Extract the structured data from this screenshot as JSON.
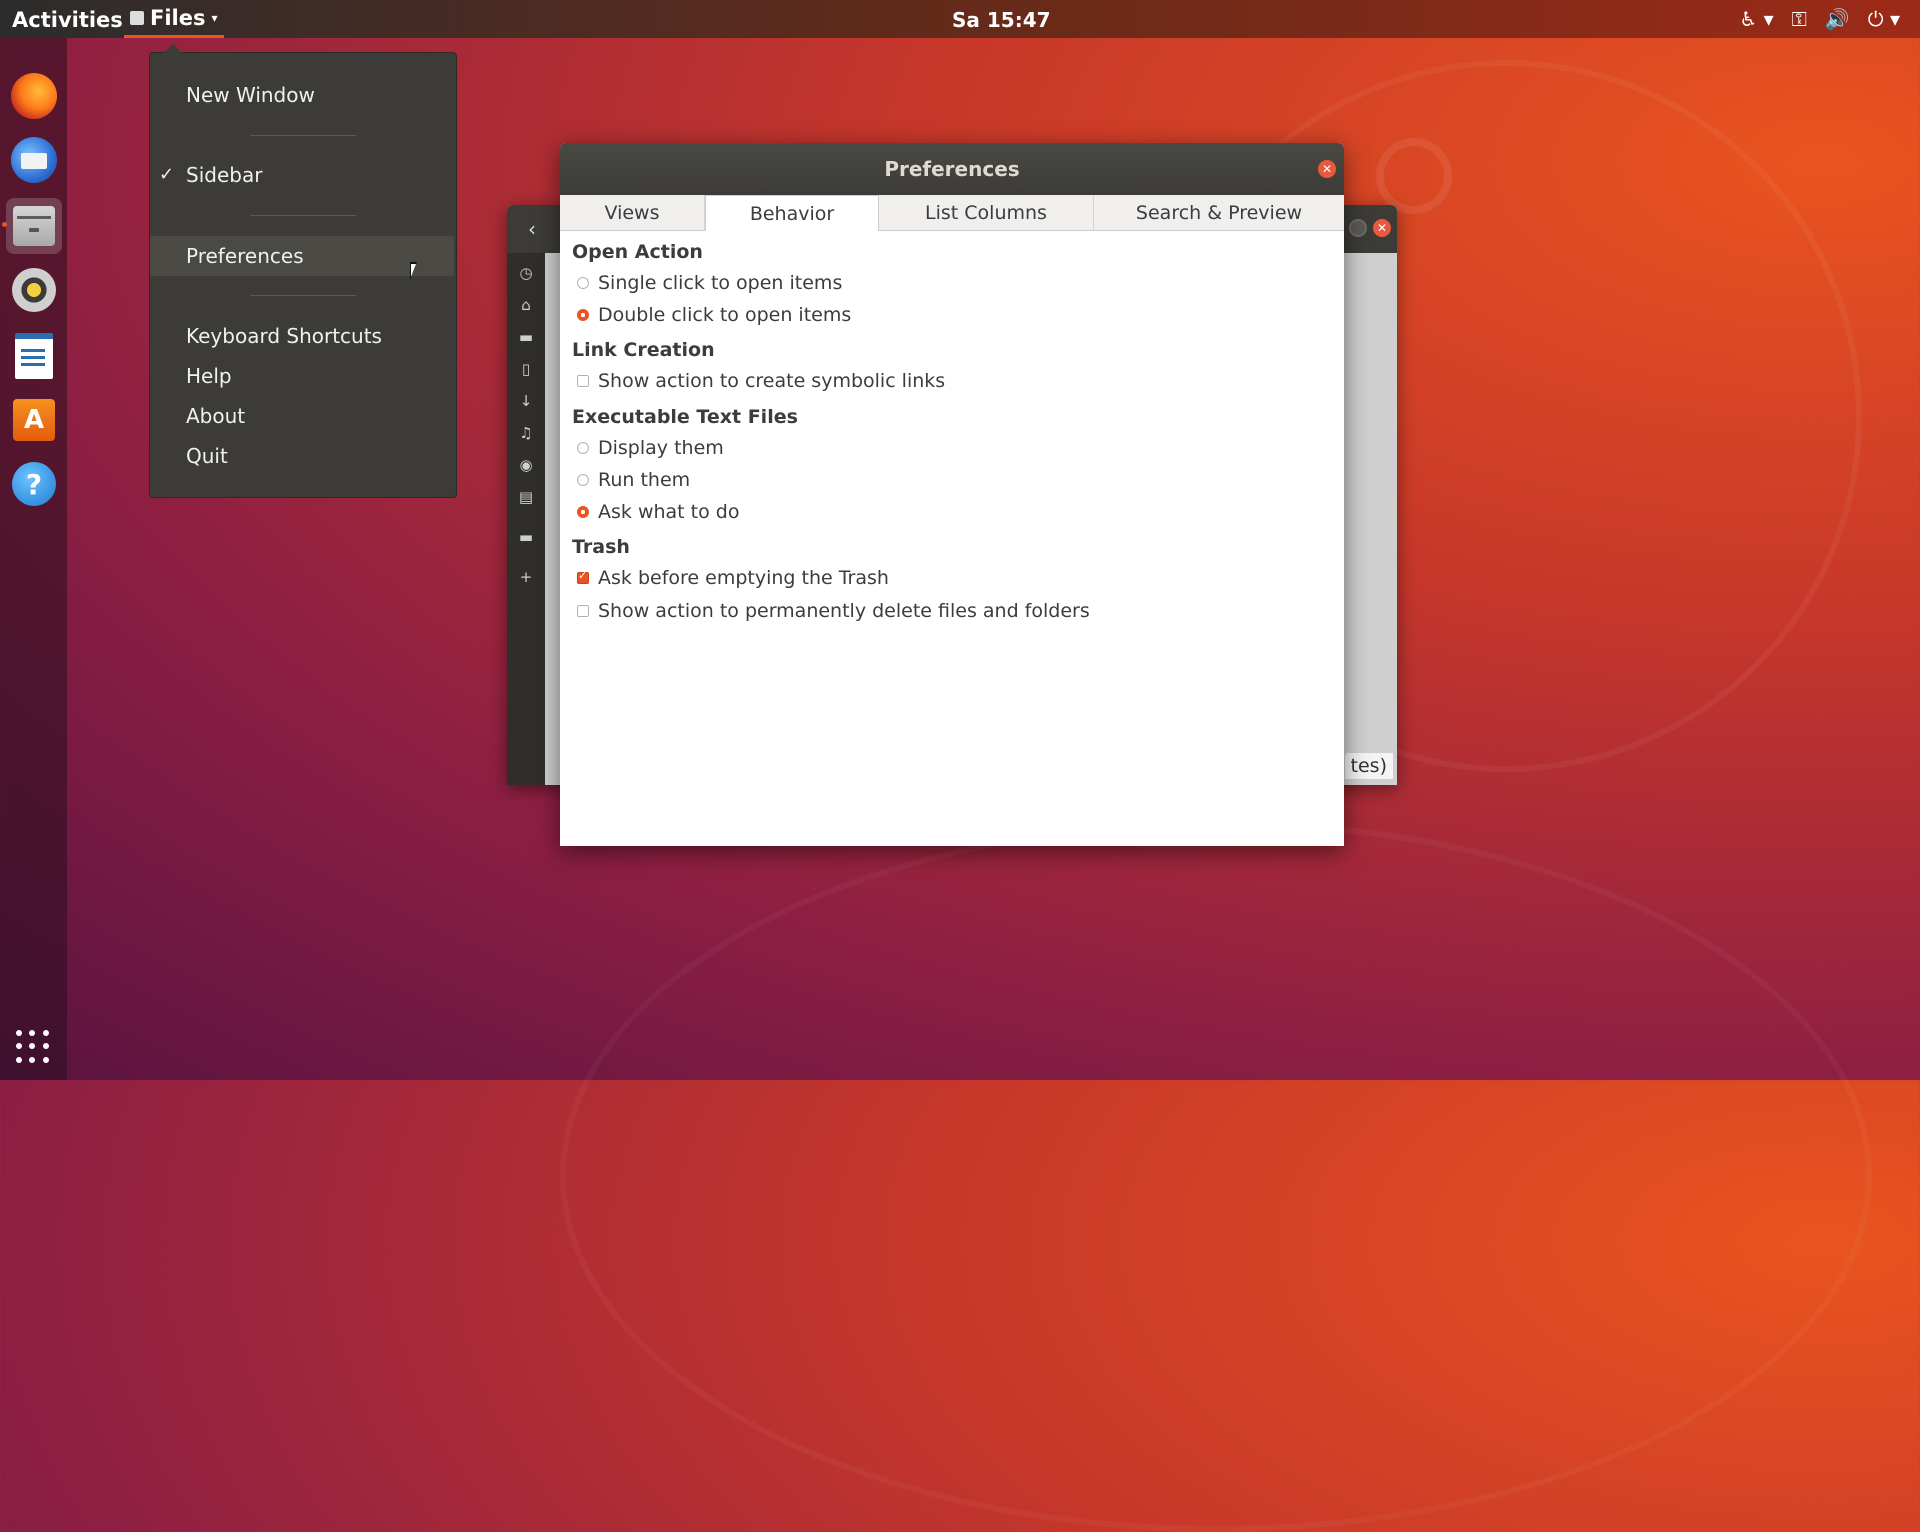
{
  "topbar": {
    "activities": "Activities",
    "app_menu_label": "Files",
    "clock": "Sa 15:47"
  },
  "dock": {
    "items": [
      "firefox-icon",
      "thunderbird-icon",
      "files-icon",
      "rhythmbox-icon",
      "writer-icon",
      "software-icon",
      "help-icon"
    ],
    "software_glyph": "A",
    "help_glyph": "?"
  },
  "app_menu": {
    "items": [
      "New Window",
      "Sidebar",
      "Preferences",
      "Keyboard Shortcuts",
      "Help",
      "About",
      "Quit"
    ],
    "sidebar_checked": true,
    "check_glyph": "✓"
  },
  "files_window": {
    "status_text": "tes)"
  },
  "preferences": {
    "title": "Preferences",
    "tabs": [
      "Views",
      "Behavior",
      "List Columns",
      "Search & Preview"
    ],
    "active_tab": "Behavior",
    "sections": {
      "open_action": {
        "title": "Open Action",
        "options": [
          "Single click to open items",
          "Double click to open items"
        ],
        "selected": "Double click to open items"
      },
      "link_creation": {
        "title": "Link Creation",
        "options": [
          "Show action to create symbolic links"
        ],
        "checked": false
      },
      "executable": {
        "title": "Executable Text Files",
        "options": [
          "Display them",
          "Run them",
          "Ask what to do"
        ],
        "selected": "Ask what to do"
      },
      "trash": {
        "title": "Trash",
        "options": [
          "Ask before emptying the Trash",
          "Show action to permanently delete files and folders"
        ],
        "checked": [
          true,
          false
        ]
      }
    }
  },
  "colors": {
    "accent": "#e95420",
    "dialog_title_bg": "#3c3b37",
    "menu_bg": "#3c3b37"
  }
}
